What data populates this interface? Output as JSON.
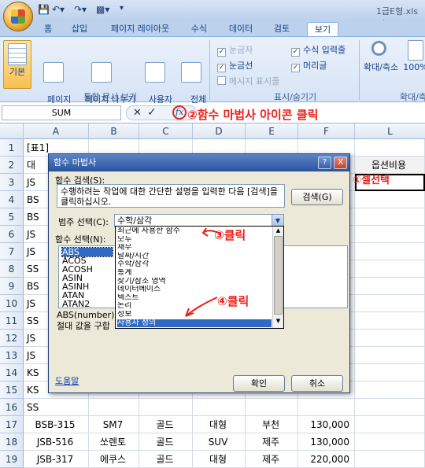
{
  "window": {
    "title": "1급E형.xls [호"
  },
  "tabs": [
    "홈",
    "삽입",
    "페이지 레이아웃",
    "수식",
    "데이터",
    "검토",
    "보기"
  ],
  "ribbon": {
    "normal": "기본",
    "page_layout": "페이지\n레이아웃",
    "page_break": "페이지 나누기\n미리 보기",
    "custom_view": "사용자\n지정 보기",
    "full_screen": "전체\n화면",
    "group_views": "통합 문서 보기",
    "gridlines": "눈금자",
    "formula_bar": "수식 입력줄",
    "grid": "눈금선",
    "headings": "머리글",
    "message_bar": "메시지 표시줄",
    "group_show": "표시/숨기기",
    "zoom": "확대/축소",
    "zoom100": "100%",
    "group_zoom": "확대/축"
  },
  "formula_bar": {
    "name_box": "SUM"
  },
  "columns": [
    "A",
    "B",
    "C",
    "D",
    "E",
    "F",
    "L"
  ],
  "rows": [
    "1",
    "2",
    "3",
    "4",
    "5",
    "6",
    "7",
    "8",
    "9",
    "10",
    "11",
    "12",
    "13",
    "14",
    "15",
    "16",
    "17",
    "18",
    "19"
  ],
  "sheet": {
    "a1": "[표1]",
    "a2": "대",
    "l2": "옵션비용",
    "col_a": [
      "JS",
      "BS",
      "BS",
      "JS",
      "JS",
      "SS",
      "BS",
      "JS",
      "SS",
      "JS",
      "JS",
      "KS",
      "KS",
      "SS",
      "SS"
    ],
    "row17": [
      "BSB-315",
      "SM7",
      "골드",
      "대형",
      "부천",
      "130,000"
    ],
    "row18": [
      "JSB-516",
      "쏘렌토",
      "골드",
      "SUV",
      "제주",
      "130,000"
    ],
    "row19": [
      "JSB-317",
      "에쿠스",
      "골드",
      "대형",
      "제주",
      "220,000"
    ]
  },
  "dialog": {
    "title": "함수 마법사",
    "search_label": "함수 검색(S):",
    "search_text": "수행하려는 작업에 대한 간단한 설명을 입력한 다음 [검색]을 클릭하십시오.",
    "search_button": "검색(G)",
    "category_label": "범주 선택(C):",
    "category_value": "수학/삼각",
    "function_label": "함수 선택(N):",
    "functions": [
      "ABS",
      "ACOS",
      "ACOSH",
      "ASIN",
      "ASINH",
      "ATAN",
      "ATAN2"
    ],
    "syntax": "ABS(number)",
    "description": "절대 값을 구합",
    "help": "도움말",
    "ok": "확인",
    "cancel": "취소",
    "help_btn": "?",
    "close_btn": "X"
  },
  "dropdown": [
    "최근에 사용한 함수",
    "모두",
    "재무",
    "날짜/시간",
    "수학/삼각",
    "통계",
    "찾기/참조 영역",
    "데이터베이스",
    "텍스트",
    "논리",
    "정보",
    "사용자 정의"
  ],
  "annotations": {
    "a1": "①셀선택",
    "a2": "②함수 마법사 아이콘 클릭",
    "a3": "③클릭",
    "a4": "④클릭"
  },
  "colors": {
    "accent": "#e8201a",
    "ribbon": "#d6e4f6",
    "selection": "#316ac5"
  }
}
